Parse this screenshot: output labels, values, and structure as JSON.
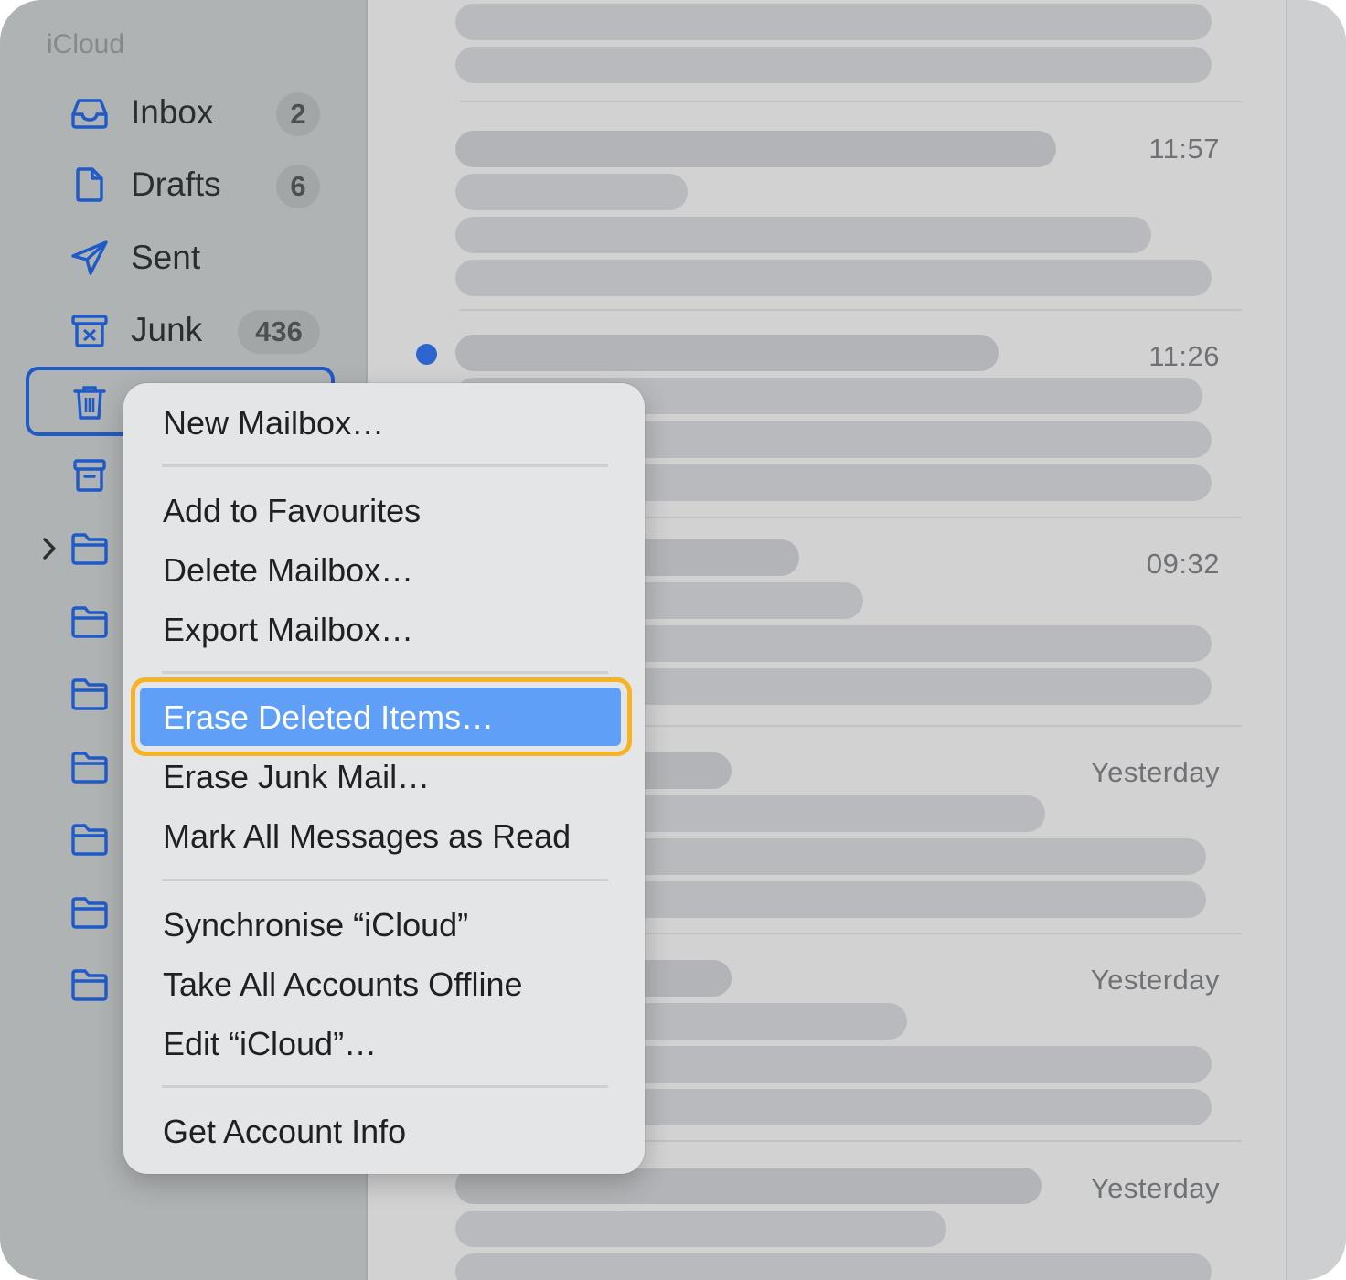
{
  "sidebar": {
    "account": "iCloud",
    "mailboxes": [
      {
        "label": "Inbox",
        "badge": "2",
        "icon": "inbox-tray-icon"
      },
      {
        "label": "Drafts",
        "badge": "6",
        "icon": "document-icon"
      },
      {
        "label": "Sent",
        "badge": "",
        "icon": "paper-plane-icon"
      },
      {
        "label": "Junk",
        "badge": "436",
        "icon": "junk-bin-icon"
      }
    ],
    "other_icons": [
      "trash-icon",
      "archive-box-icon",
      "folder-icon",
      "folder-icon",
      "folder-icon",
      "folder-icon",
      "folder-icon",
      "folder-icon",
      "folder-icon"
    ]
  },
  "messages": {
    "times": [
      "11:57",
      "11:26",
      "09:32",
      "Yesterday",
      "Yesterday",
      "Yesterday"
    ],
    "unread_index": 1
  },
  "context_menu": {
    "items": [
      "New Mailbox…",
      "Add to Favourites",
      "Delete Mailbox…",
      "Export Mailbox…",
      "Erase Deleted Items…",
      "Erase Junk Mail…",
      "Mark All Messages as Read",
      "Synchronise “iCloud”",
      "Take All Accounts Offline",
      "Edit “iCloud”…",
      "Get Account Info"
    ],
    "highlighted": "Erase Deleted Items…"
  },
  "colors": {
    "accent_blue": "#1f5ac9",
    "highlight_blue": "#5f9ff7",
    "highlight_outline": "#f6b324",
    "unread_dot": "#2c65cf"
  }
}
